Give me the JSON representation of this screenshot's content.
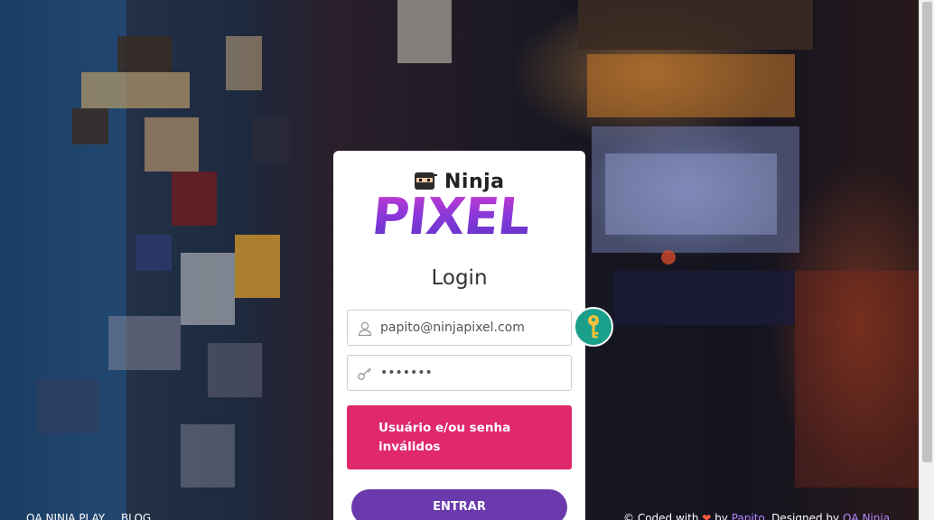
{
  "colors": {
    "accent": "#e0286c",
    "button": "#6a3aad",
    "key_badge": "#1aa08a",
    "link": "#b586ff"
  },
  "logo": {
    "top_word": "Ninja",
    "main_word": "PIXEL",
    "mask_icon": "ninja-mask-icon"
  },
  "login": {
    "title": "Login",
    "email_value": "papito@ninjapixel.com",
    "email_icon": "user-icon",
    "password_value": "•••••••",
    "password_icon": "key-icon",
    "key_badge_icon": "key-icon",
    "error_message": "Usuário e/ou senha inválidos",
    "submit_label": "ENTRAR"
  },
  "footer": {
    "links": [
      "QA NINJA PLAY",
      "BLOG"
    ],
    "credit_prefix": "© Coded with",
    "credit_heart": "❤",
    "credit_by": "by",
    "credit_author": "Papito",
    "credit_designed": ". Designed by",
    "credit_designer": "QA Ninja"
  }
}
